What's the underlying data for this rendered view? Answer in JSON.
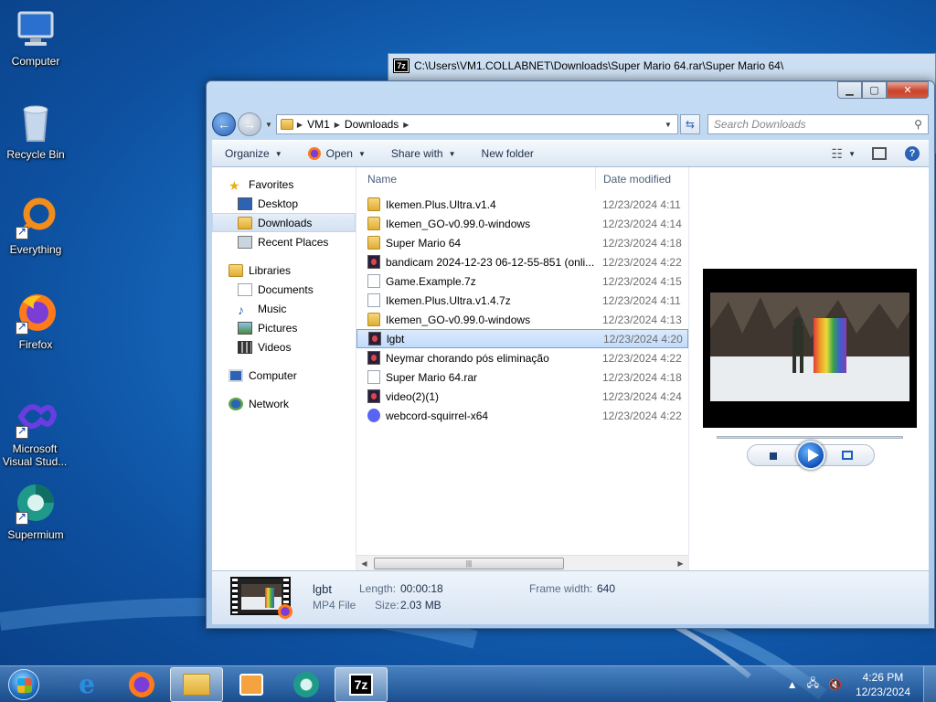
{
  "desktop": {
    "icons": [
      {
        "label": "Computer"
      },
      {
        "label": "Recycle Bin"
      },
      {
        "label": "Everything"
      },
      {
        "label": "Firefox"
      },
      {
        "label": "Microsoft Visual Stud..."
      },
      {
        "label": "Supermium"
      }
    ]
  },
  "zip_window": {
    "title": "C:\\Users\\VM1.COLLABNET\\Downloads\\Super Mario 64.rar\\Super Mario 64\\",
    "icon_text": "7z"
  },
  "explorer": {
    "breadcrumb": [
      "VM1",
      "Downloads"
    ],
    "search_placeholder": "Search Downloads",
    "toolbar": {
      "organize": "Organize",
      "open": "Open",
      "share_with": "Share with",
      "new_folder": "New folder"
    },
    "nav": {
      "favorites": "Favorites",
      "desktop": "Desktop",
      "downloads": "Downloads",
      "recent_places": "Recent Places",
      "libraries": "Libraries",
      "documents": "Documents",
      "music": "Music",
      "pictures": "Pictures",
      "videos": "Videos",
      "computer": "Computer",
      "network": "Network"
    },
    "columns": {
      "name": "Name",
      "date_modified": "Date modified"
    },
    "files": [
      {
        "name": "Ikemen.Plus.Ultra.v1.4",
        "date": "12/23/2024 4:11",
        "type": "folder"
      },
      {
        "name": "Ikemen_GO-v0.99.0-windows",
        "date": "12/23/2024 4:14",
        "type": "folder"
      },
      {
        "name": "Super Mario 64",
        "date": "12/23/2024 4:18",
        "type": "folder"
      },
      {
        "name": "bandicam 2024-12-23 06-12-55-851 (onli...",
        "date": "12/23/2024 4:22",
        "type": "video"
      },
      {
        "name": "Game.Example.7z",
        "date": "12/23/2024 4:15",
        "type": "file"
      },
      {
        "name": "Ikemen.Plus.Ultra.v1.4.7z",
        "date": "12/23/2024 4:11",
        "type": "file"
      },
      {
        "name": "Ikemen_GO-v0.99.0-windows",
        "date": "12/23/2024 4:13",
        "type": "archive"
      },
      {
        "name": "lgbt",
        "date": "12/23/2024 4:20",
        "type": "video"
      },
      {
        "name": "Neymar chorando pós eliminação",
        "date": "12/23/2024 4:22",
        "type": "video"
      },
      {
        "name": "Super Mario 64.rar",
        "date": "12/23/2024 4:18",
        "type": "file"
      },
      {
        "name": "video(2)(1)",
        "date": "12/23/2024 4:24",
        "type": "video"
      },
      {
        "name": "webcord-squirrel-x64",
        "date": "12/23/2024 4:22",
        "type": "discord"
      }
    ],
    "selected_index": 7,
    "details": {
      "name": "lgbt",
      "type": "MP4 File",
      "length_label": "Length:",
      "length": "00:00:18",
      "size_label": "Size:",
      "size": "2.03 MB",
      "frame_width_label": "Frame width:",
      "frame_width": "640"
    }
  },
  "taskbar": {
    "time": "4:26 PM",
    "date": "12/23/2024",
    "zip_label": "7z"
  },
  "colors": {
    "desktop_bg": "#1a6fc4",
    "selection": "#c1dbfc",
    "accent": "#2c63b5"
  }
}
